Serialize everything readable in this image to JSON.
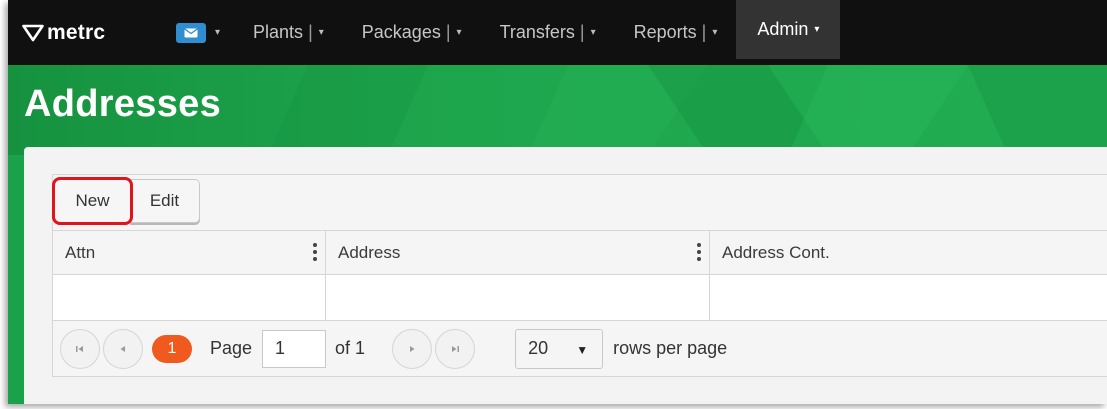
{
  "brand": {
    "name": "metrc"
  },
  "nav": {
    "items": [
      {
        "label": "Plants",
        "sep": "|"
      },
      {
        "label": "Packages",
        "sep": "|"
      },
      {
        "label": "Transfers",
        "sep": "|"
      },
      {
        "label": "Reports",
        "sep": "|"
      }
    ],
    "active": {
      "label": "Admin"
    },
    "caret": "▾"
  },
  "page": {
    "title": "Addresses"
  },
  "toolbar": {
    "new_label": "New",
    "edit_label": "Edit"
  },
  "grid": {
    "columns": [
      "Attn",
      "Address",
      "Address Cont."
    ],
    "rows": [
      [
        "",
        "",
        ""
      ]
    ]
  },
  "pager": {
    "current_page_badge": "1",
    "page_label": "Page",
    "page_value": "1",
    "of_label": "of 1",
    "page_size": "20",
    "rows_label": "rows per page"
  },
  "colors": {
    "navbar": "#101010",
    "banner_green": "#1ea64d",
    "mail_badge": "#2f8ed0",
    "page_badge": "#f05a1f",
    "highlight": "#e0151b"
  }
}
